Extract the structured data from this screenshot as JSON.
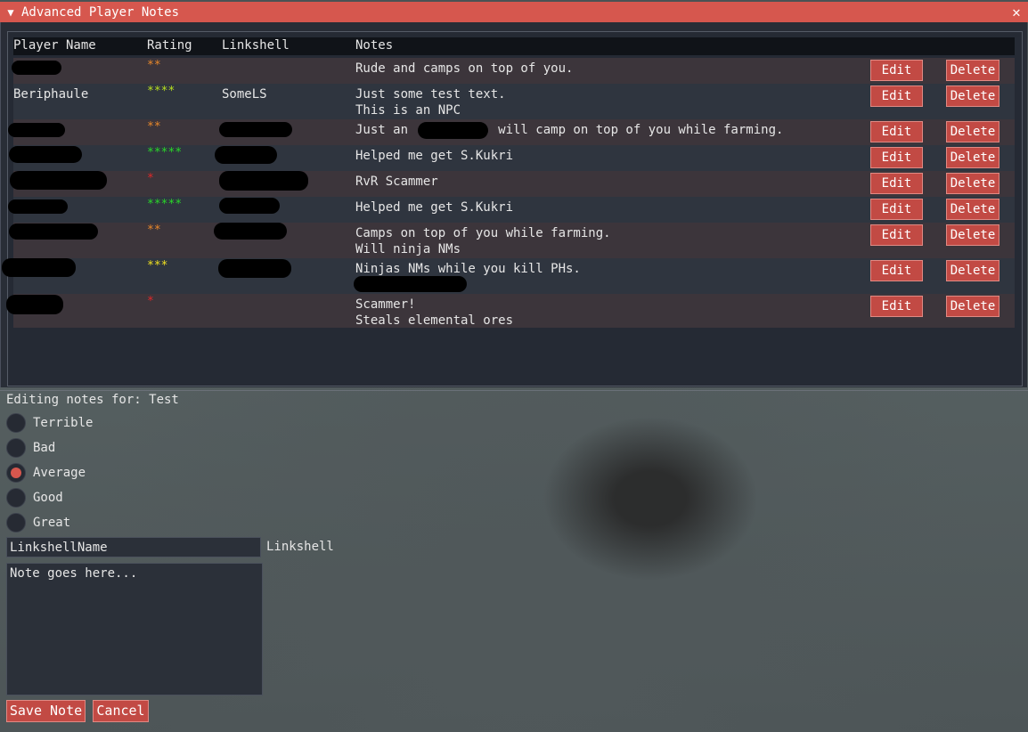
{
  "window": {
    "title": "Advanced Player Notes",
    "collapse_icon": "triangle-down-icon",
    "close_icon": "close-x-icon"
  },
  "table": {
    "headers": {
      "name": "Player Name",
      "rating": "Rating",
      "linkshell": "Linkshell",
      "notes": "Notes"
    },
    "edit_label": "Edit",
    "delete_label": "Delete",
    "rows": [
      {
        "name": "",
        "rating": "**",
        "rating_color": "#e8882a",
        "linkshell": "",
        "note1": "Rude and camps on top of you.",
        "note2": ""
      },
      {
        "name": "Beriphaule",
        "rating": "****",
        "rating_color": "#b8e020",
        "linkshell": "SomeLS",
        "note1": "Just some test text.",
        "note2": "This is an NPC"
      },
      {
        "name": "",
        "rating": "**",
        "rating_color": "#e8882a",
        "linkshell": "",
        "note1": "Just an          , will camp on top of you while farming.",
        "note2": ""
      },
      {
        "name": "",
        "rating": "*****",
        "rating_color": "#28d828",
        "linkshell": "",
        "note1": "Helped me get S.Kukri",
        "note2": ""
      },
      {
        "name": "",
        "rating": "*",
        "rating_color": "#e02828",
        "linkshell": "",
        "note1": "RvR Scammer",
        "note2": ""
      },
      {
        "name": "",
        "rating": "*****",
        "rating_color": "#28d828",
        "linkshell": "",
        "note1": "Helped me get S.Kukri",
        "note2": ""
      },
      {
        "name": "",
        "rating": "**",
        "rating_color": "#e8882a",
        "linkshell": "",
        "note1": "Camps on top of you while farming.",
        "note2": "Will ninja NMs"
      },
      {
        "name": "",
        "rating": "***",
        "rating_color": "#f0e020",
        "linkshell": "",
        "note1": "Ninjas NMs while you kill PHs.",
        "note2": ""
      },
      {
        "name": "",
        "rating": "*",
        "rating_color": "#e02828",
        "linkshell": "",
        "note1": "Scammer!",
        "note2": "Steals elemental ores"
      }
    ]
  },
  "editor": {
    "editing_label": "Editing notes for: Test",
    "ratings": [
      "Terrible",
      "Bad",
      "Average",
      "Good",
      "Great"
    ],
    "selected_rating": "Average",
    "linkshell_value": "LinkshellName",
    "linkshell_label": "Linkshell",
    "note_placeholder": "Note goes here...",
    "save_label": "Save Note",
    "cancel_label": "Cancel"
  },
  "colors": {
    "accent": "#d6574e",
    "button": "#c24a44"
  }
}
